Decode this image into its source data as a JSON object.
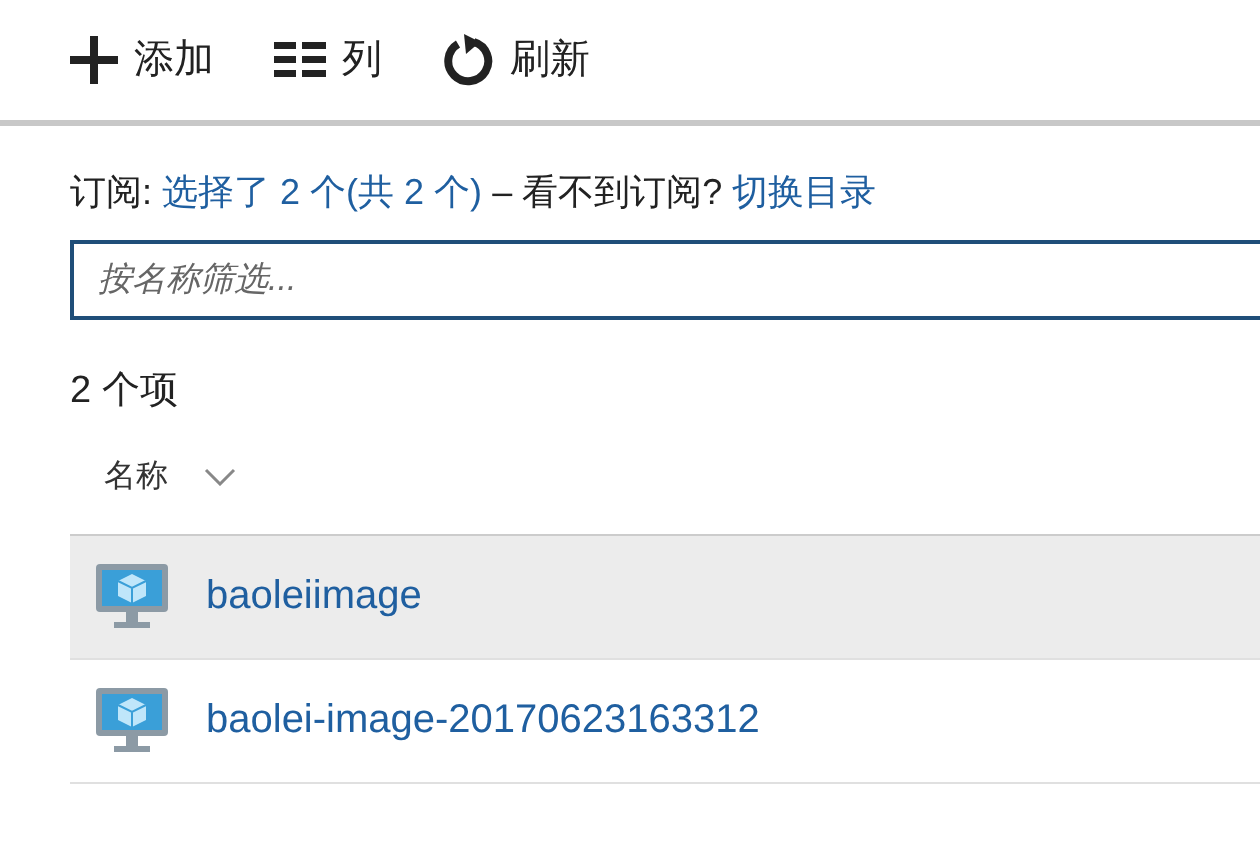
{
  "toolbar": [
    {
      "kind": "add",
      "label": "添加"
    },
    {
      "kind": "columns",
      "label": "列"
    },
    {
      "kind": "refresh",
      "label": "刷新"
    }
  ],
  "subscription": {
    "label": "订阅:",
    "selection": "选择了 2 个(共 2 个)",
    "separator": "–",
    "question": "看不到订阅?",
    "link": "切换目录"
  },
  "filter": {
    "placeholder": "按名称筛选..."
  },
  "count": "2 个项",
  "table": {
    "columns": [
      {
        "label": "名称"
      }
    ],
    "rows": [
      {
        "name": "baoleiimage",
        "selected": true
      },
      {
        "name": "baolei-image-20170623163312",
        "selected": false
      }
    ]
  }
}
